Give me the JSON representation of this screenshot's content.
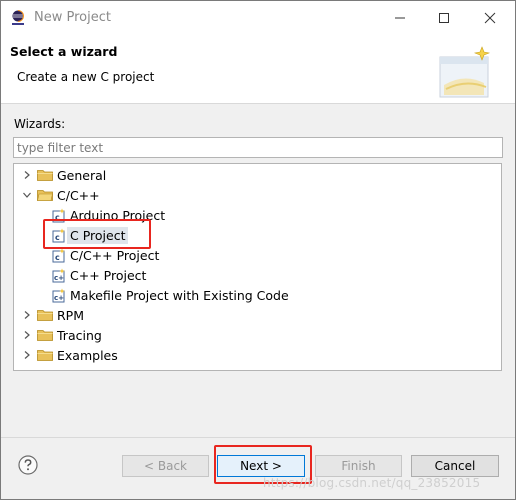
{
  "window": {
    "title": "New Project",
    "app_icon_label": "eclipse"
  },
  "header": {
    "title": "Select a wizard",
    "description": "Create a new C project"
  },
  "wizards_label": "Wizards:",
  "filter": {
    "placeholder": "type filter text",
    "value": ""
  },
  "tree": {
    "items": [
      {
        "label": "General",
        "type": "folder",
        "expanded": false
      },
      {
        "label": "C/C++",
        "type": "folder",
        "expanded": true
      },
      {
        "label": "Arduino Project",
        "type": "c-project"
      },
      {
        "label": "C Project",
        "type": "c-project",
        "selected": true
      },
      {
        "label": "C/C++ Project",
        "type": "c-project"
      },
      {
        "label": "C++ Project",
        "type": "c-project"
      },
      {
        "label": "Makefile Project with Existing Code",
        "type": "c-project"
      },
      {
        "label": "RPM",
        "type": "folder",
        "expanded": false
      },
      {
        "label": "Tracing",
        "type": "folder",
        "expanded": false
      },
      {
        "label": "Examples",
        "type": "folder",
        "expanded": false
      }
    ]
  },
  "buttons": {
    "back": "< Back",
    "next": "Next >",
    "finish": "Finish",
    "cancel": "Cancel"
  },
  "watermark": "https://blog.csdn.net/qq_23852015",
  "colors": {
    "highlight_red": "#e8261f",
    "folder_yellow": "#e8c15a",
    "selection": "#dfe5ec"
  }
}
